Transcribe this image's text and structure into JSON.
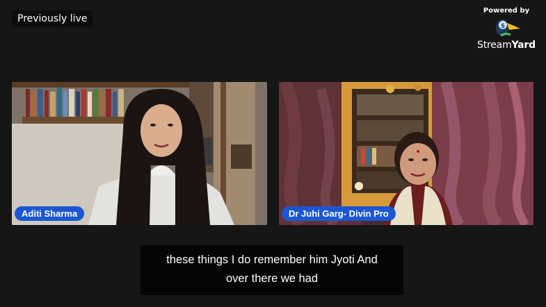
{
  "stream": {
    "status": "Previously live"
  },
  "branding": {
    "powered_by": "Powered by",
    "name_regular": "Stream",
    "name_bold": "Yard",
    "logo_icon": "duck-logo-icon"
  },
  "participants": [
    {
      "name": "Aditi Sharma"
    },
    {
      "name": "Dr Juhi Garg- Divin Pro"
    }
  ],
  "captions": {
    "line1": "these things I do remember him Jyoti And",
    "line2": "over there we had"
  },
  "colors": {
    "name_tag": "#1b57d3",
    "background": "#161616",
    "caption_bg": "#050505"
  }
}
